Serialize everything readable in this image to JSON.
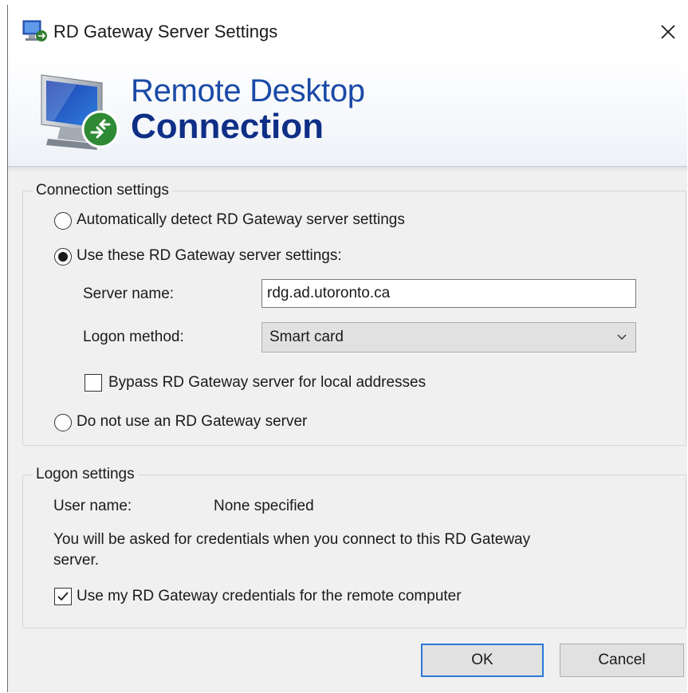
{
  "window": {
    "title": "RD Gateway Server Settings"
  },
  "banner": {
    "line1": "Remote Desktop",
    "line2": "Connection"
  },
  "connection_settings": {
    "legend": "Connection settings",
    "auto_detect_label": "Automatically detect RD Gateway server settings",
    "use_settings_label": "Use these RD Gateway server settings:",
    "selected_option": "use_settings",
    "server_name_label": "Server name:",
    "server_name_value": "rdg.ad.utoronto.ca",
    "logon_method_label": "Logon method:",
    "logon_method_value": "Smart card",
    "bypass_label": "Bypass RD Gateway server for local addresses",
    "bypass_checked": false,
    "no_gateway_label": "Do not use an RD Gateway server"
  },
  "logon_settings": {
    "legend": "Logon settings",
    "user_name_label": "User name:",
    "user_name_value": "None specified",
    "info_text_line1": "You will be asked for credentials when you connect to this RD Gateway",
    "info_text_line2": "server.",
    "use_credentials_label": "Use my RD Gateway credentials for the remote computer",
    "use_credentials_checked": true
  },
  "buttons": {
    "ok": "OK",
    "cancel": "Cancel"
  },
  "colors": {
    "brand_blue": "#1a4aa6",
    "brand_dark_blue": "#0f2f86",
    "default_button_border": "#2b79d8"
  },
  "icons": {
    "title_icon": "rdc-icon",
    "close": "close-icon",
    "banner": "monitor-icon",
    "dropdown": "chevron-down-icon"
  }
}
